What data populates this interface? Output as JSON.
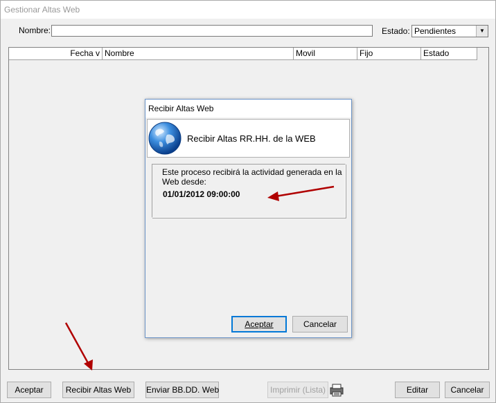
{
  "window": {
    "title": "Gestionar Altas Web"
  },
  "filters": {
    "nombre_label": "Nombre:",
    "nombre_value": "",
    "estado_label": "Estado:",
    "estado_selected": "Pendientes"
  },
  "grid": {
    "columns": [
      "Fecha v",
      "Nombre",
      "Movil",
      "Fijo",
      "Estado"
    ],
    "rows": []
  },
  "dialog": {
    "title": "Recibir Altas Web",
    "header_text": "Recibir Altas RR.HH. de la WEB",
    "info_line": "Este proceso recibirá la actividad generada en la Web desde:",
    "date": "01/01/2012 09:00:00",
    "accept_label": "Aceptar",
    "cancel_label": "Cancelar"
  },
  "toolbar": {
    "aceptar": "Aceptar",
    "recibir": "Recibir Altas Web",
    "enviar": "Enviar BB.DD. Web",
    "imprimir": "Imprimir (Lista)",
    "editar": "Editar",
    "cancelar": "Cancelar"
  },
  "colors": {
    "annotation_arrow": "#b00000",
    "dialog_border": "#6b94c8",
    "default_button_border": "#0078d7"
  },
  "icons": {
    "dialog_header": "globe-icon",
    "print": "printer-icon"
  }
}
